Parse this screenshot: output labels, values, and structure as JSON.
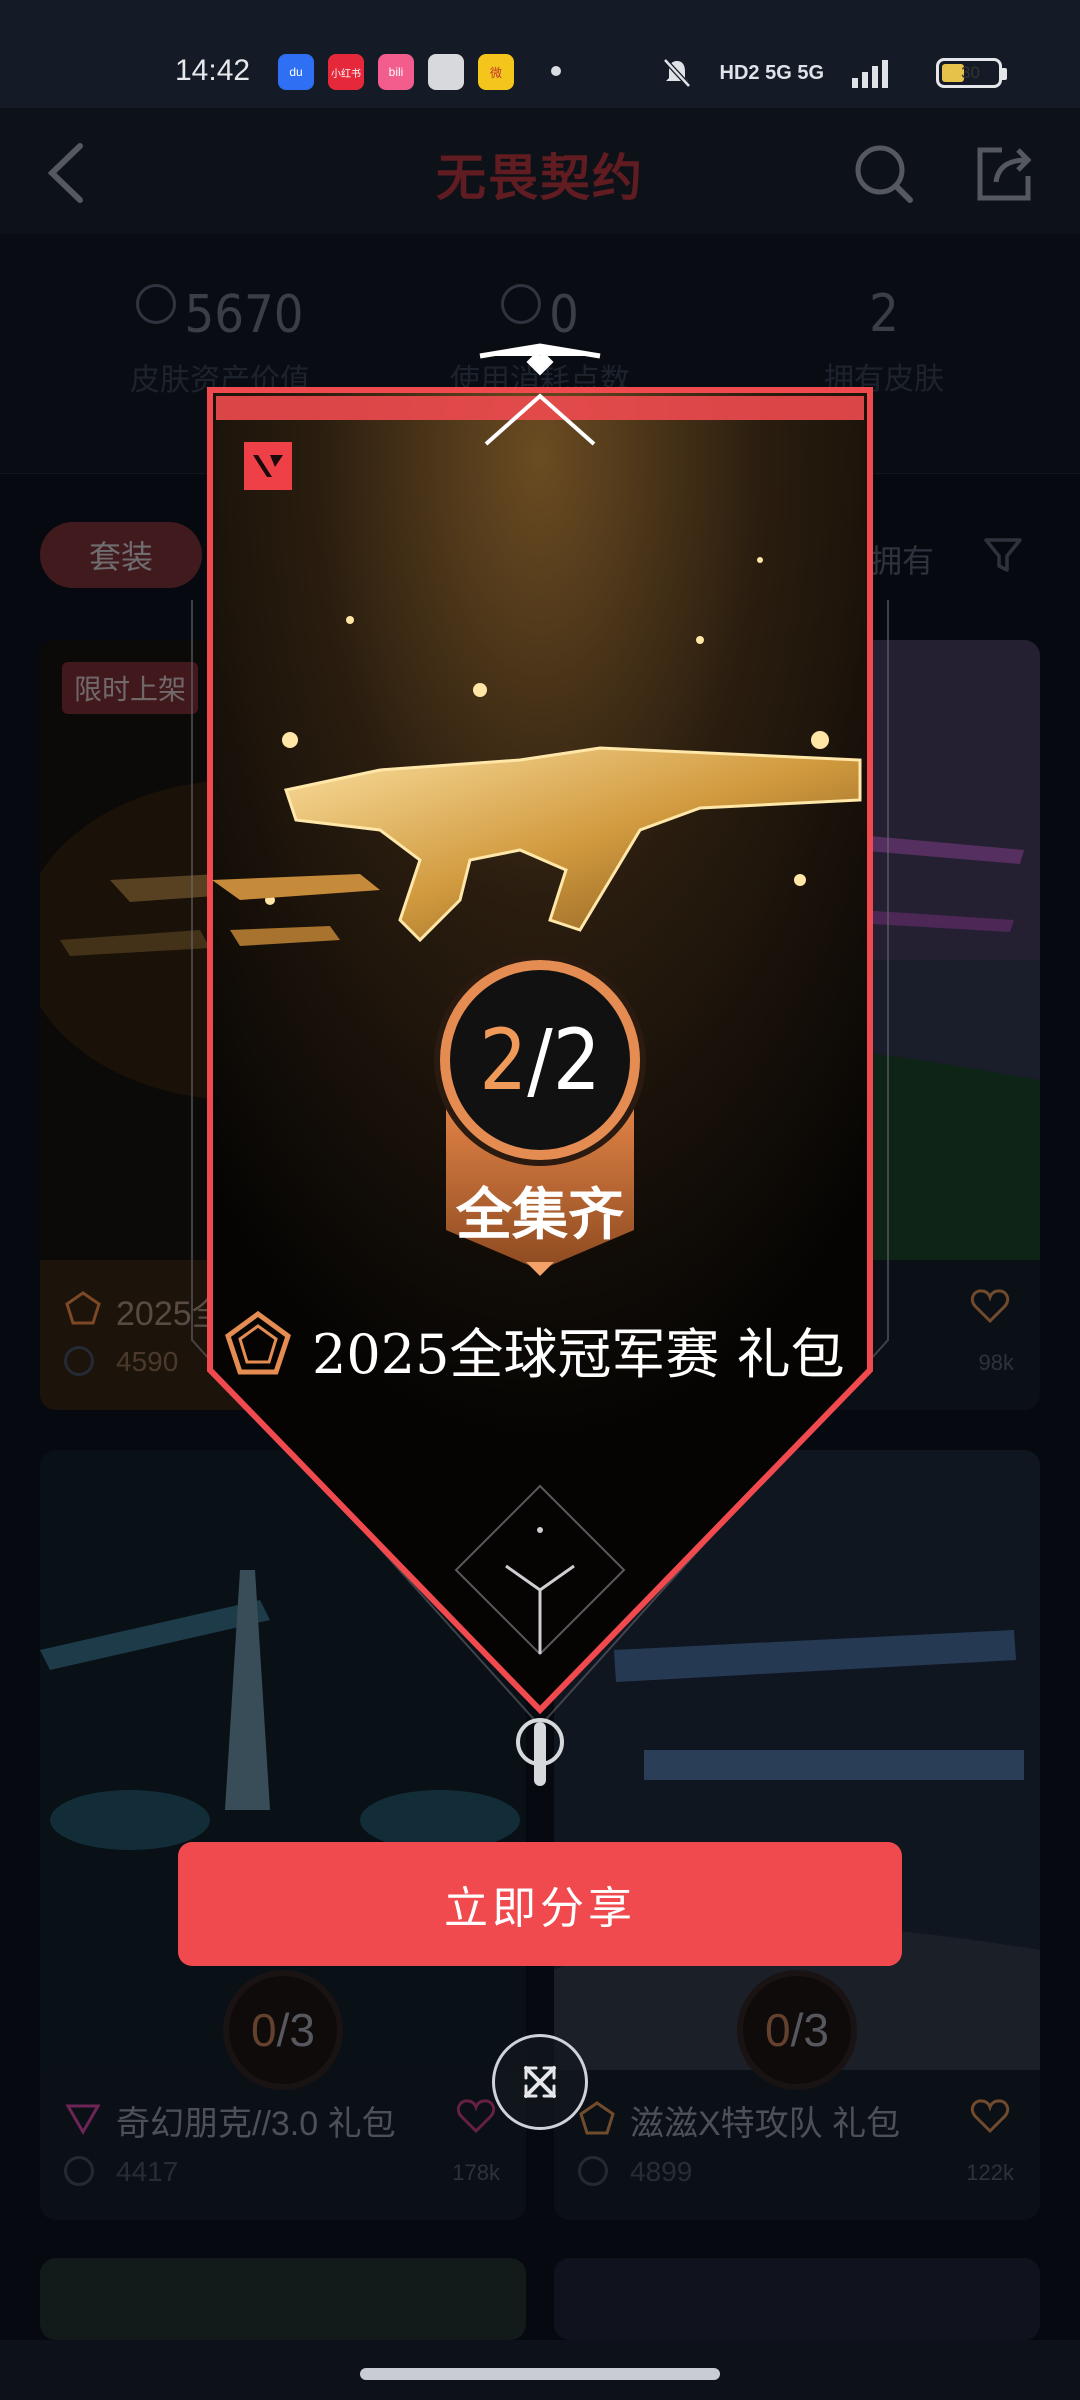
{
  "status_bar": {
    "time": "14:42",
    "apps": [
      {
        "name": "baidu-app-icon",
        "label": "du",
        "color": "#2f6ff3"
      },
      {
        "name": "xiaohongshu-app-icon",
        "label": "小红书",
        "color": "#e6283b"
      },
      {
        "name": "bilibili-app-icon",
        "label": "bili",
        "color": "#f25d8e"
      },
      {
        "name": "blank-app-icon",
        "label": "",
        "color": "#d8d9dc"
      },
      {
        "name": "weibo-app-icon",
        "label": "微",
        "color": "#f4c51b"
      }
    ],
    "network": "HD2  5G  5G",
    "battery": "30"
  },
  "header": {
    "logo_text": "无畏契约"
  },
  "stats": [
    {
      "value": "5670",
      "label": "皮肤资产价值"
    },
    {
      "value": "0",
      "label": "使用消耗点数"
    },
    {
      "value": "2",
      "label": "拥有皮肤"
    }
  ],
  "filters": {
    "suit_chip": "套装",
    "owned_label": "拥有"
  },
  "cards": [
    {
      "title": "2025全球冠军赛 礼包",
      "price": "4590",
      "likes": "",
      "tag": "限时上架",
      "progress_current": "",
      "progress_total": ""
    },
    {
      "title": "",
      "price": "",
      "likes": "98k",
      "tag": "",
      "progress_current": "",
      "progress_total": ""
    },
    {
      "title": "奇幻朋克//3.0 礼包",
      "price": "4417",
      "likes": "178k",
      "tag": "",
      "progress_current": "0",
      "progress_total": "/3"
    },
    {
      "title": "滋滋X特攻队 礼包",
      "price": "4899",
      "likes": "122k",
      "tag": "",
      "progress_current": "0",
      "progress_total": "/3"
    }
  ],
  "modal": {
    "progress_current": "2",
    "progress_total": "/2",
    "complete_label": "全集齐",
    "title": "2025全球冠军赛 礼包",
    "share_button": "立即分享",
    "accent_color": "#f04a4f",
    "ring_color": "#e58c52"
  }
}
